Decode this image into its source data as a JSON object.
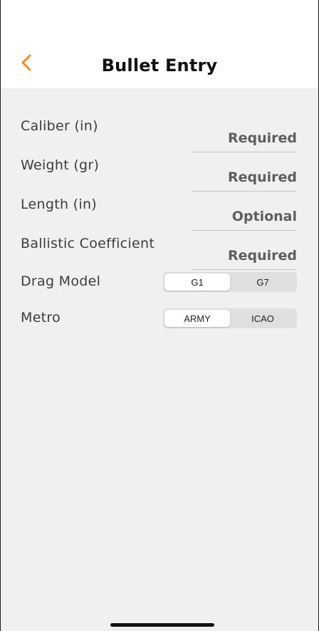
{
  "colors": {
    "accent": "#F08A2C",
    "background": "#F0F0F0",
    "header": "#FFFFFF",
    "segment_track": "#DFDFDF"
  },
  "header": {
    "back_icon": "chevron-left-icon",
    "title": "Bullet Entry"
  },
  "fields": [
    {
      "label": "Caliber (in)",
      "placeholder": "Required",
      "value": ""
    },
    {
      "label": "Weight (gr)",
      "placeholder": "Required",
      "value": ""
    },
    {
      "label": "Length (in)",
      "placeholder": "Optional",
      "value": ""
    },
    {
      "label": "Ballistic Coefficient",
      "placeholder": "Required",
      "value": ""
    }
  ],
  "drag_model": {
    "label": "Drag Model",
    "options": [
      "G1",
      "G7"
    ],
    "selected": "G1"
  },
  "metro": {
    "label": "Metro",
    "options": [
      "ARMY",
      "ICAO"
    ],
    "selected": "ARMY"
  }
}
